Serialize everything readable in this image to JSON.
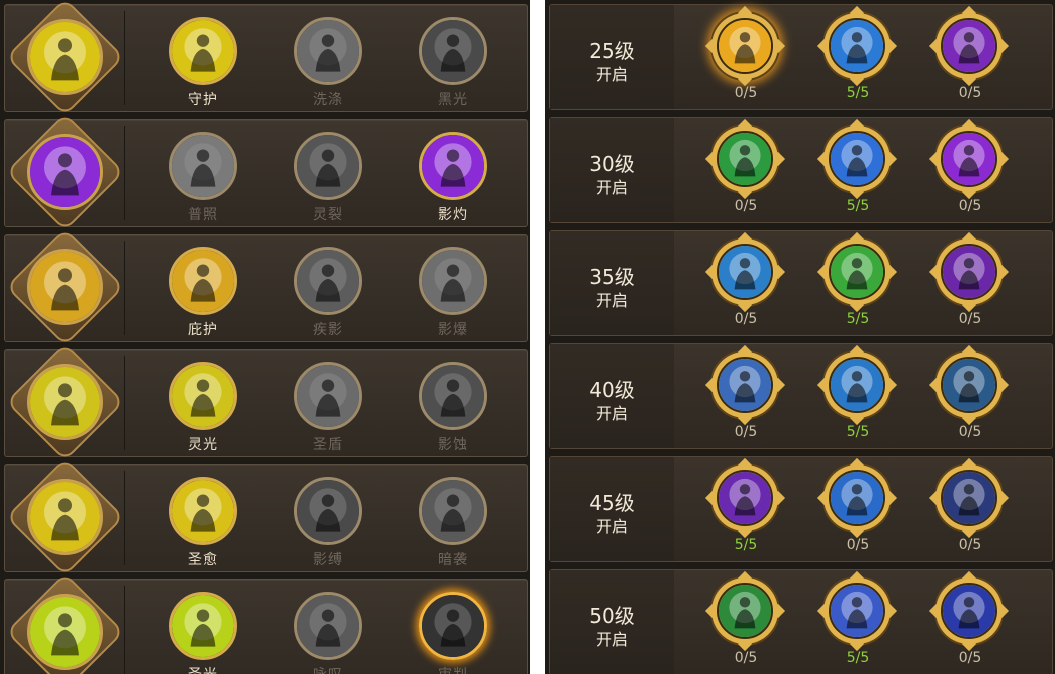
{
  "left_panel": {
    "rows": [
      {
        "base_icon": "hand-holding-light-icon",
        "base_color": "#d9c415",
        "skills": [
          {
            "name": "守护",
            "icon": "hand-holding-light-icon",
            "learned": true,
            "color": "#d9c415"
          },
          {
            "name": "洗涤",
            "icon": "light-pillar-icon",
            "learned": false,
            "color": "#6b6b6b"
          },
          {
            "name": "黑光",
            "icon": "dark-orb-icon",
            "learned": false,
            "color": "#4a4a4a"
          }
        ]
      },
      {
        "base_icon": "shadow-figure-icon",
        "base_color": "#8a2bd6",
        "skills": [
          {
            "name": "普照",
            "icon": "radiant-figure-icon",
            "learned": false,
            "color": "#7a7a7a"
          },
          {
            "name": "灵裂",
            "icon": "spirit-rift-icon",
            "learned": false,
            "color": "#555555"
          },
          {
            "name": "影灼",
            "icon": "shadow-figure-icon",
            "learned": true,
            "color": "#8a2bd6"
          }
        ]
      },
      {
        "base_icon": "shield-icon",
        "base_color": "#d8a520",
        "skills": [
          {
            "name": "庇护",
            "icon": "shield-icon",
            "learned": true,
            "color": "#d8a520"
          },
          {
            "name": "疾影",
            "icon": "shatter-icon",
            "learned": false,
            "color": "#5c5c5c"
          },
          {
            "name": "影爆",
            "icon": "light-pillar-icon",
            "learned": false,
            "color": "#6e6e6e"
          }
        ]
      },
      {
        "base_icon": "glowing-palm-icon",
        "base_color": "#cfc21a",
        "skills": [
          {
            "name": "灵光",
            "icon": "glowing-palm-icon",
            "learned": true,
            "color": "#cfc21a"
          },
          {
            "name": "圣盾",
            "icon": "holy-shield-icon",
            "learned": false,
            "color": "#6b6b6b"
          },
          {
            "name": "影蚀",
            "icon": "shadow-clones-icon",
            "learned": false,
            "color": "#4f4f4f"
          }
        ]
      },
      {
        "base_icon": "sunburst-hand-icon",
        "base_color": "#d8c018",
        "skills": [
          {
            "name": "圣愈",
            "icon": "sunburst-hand-icon",
            "learned": true,
            "color": "#d8c018"
          },
          {
            "name": "影缚",
            "icon": "shadow-strike-icon",
            "learned": false,
            "color": "#4a4a4a"
          },
          {
            "name": "暗袭",
            "icon": "comet-icon",
            "learned": false,
            "color": "#5a5a5a"
          }
        ]
      },
      {
        "base_icon": "holy-light-figure-icon",
        "base_color": "#b8d21a",
        "skills": [
          {
            "name": "圣光",
            "icon": "holy-light-figure-icon",
            "learned": true,
            "color": "#b8d21a"
          },
          {
            "name": "咏叹",
            "icon": "crowd-icon",
            "learned": false,
            "color": "#5a5a5a"
          },
          {
            "name": "审判",
            "icon": "dark-figure-icon",
            "learned": false,
            "highlight": true,
            "color": "#333333"
          }
        ]
      }
    ]
  },
  "right_panel": {
    "rows": [
      {
        "level": "25级",
        "open": "开启",
        "talents": [
          {
            "icon": "golden-cross-icon",
            "count": "0/5",
            "color": "#e9a820",
            "glow": true
          },
          {
            "icon": "blue-warrior-icon",
            "count": "5/5",
            "color": "#2a7ad6"
          },
          {
            "icon": "purple-claw-icon",
            "count": "0/5",
            "color": "#7a2ab8"
          }
        ]
      },
      {
        "level": "30级",
        "open": "开启",
        "talents": [
          {
            "icon": "green-figure-icon",
            "count": "0/5",
            "color": "#2c9a3e"
          },
          {
            "icon": "blue-impact-icon",
            "count": "5/5",
            "color": "#2f6fd8"
          },
          {
            "icon": "purple-wave-icon",
            "count": "0/5",
            "color": "#8a2ad0"
          }
        ]
      },
      {
        "level": "35级",
        "open": "开启",
        "talents": [
          {
            "icon": "lightning-strike-icon",
            "count": "0/5",
            "color": "#2a7fc8"
          },
          {
            "icon": "green-heal-cross-icon",
            "count": "5/5",
            "color": "#3aa83a"
          },
          {
            "icon": "hooded-mage-icon",
            "count": "0/5",
            "color": "#6a28a8"
          }
        ]
      },
      {
        "level": "40级",
        "open": "开启",
        "talents": [
          {
            "icon": "golden-warrior-icon",
            "count": "0/5",
            "color": "#3a6ab8"
          },
          {
            "icon": "winged-crest-icon",
            "count": "5/5",
            "color": "#2a78c8"
          },
          {
            "icon": "spirit-figure-icon",
            "count": "0/5",
            "color": "#2a5a8a"
          }
        ]
      },
      {
        "level": "45级",
        "open": "开启",
        "talents": [
          {
            "icon": "purple-hood-icon",
            "count": "5/5",
            "color": "#6a2ab0"
          },
          {
            "icon": "golden-shield-icon",
            "count": "0/5",
            "color": "#2a6ac8"
          },
          {
            "icon": "wizard-hat-icon",
            "count": "0/5",
            "color": "#2a3a7a"
          }
        ]
      },
      {
        "level": "50级",
        "open": "开启",
        "talents": [
          {
            "icon": "green-flexing-figure-icon",
            "count": "0/5",
            "color": "#2c8a3a"
          },
          {
            "icon": "golden-angel-icon",
            "count": "5/5",
            "color": "#3a5ac8"
          },
          {
            "icon": "blue-vortex-icon",
            "count": "0/5",
            "color": "#2a3aa8"
          }
        ]
      }
    ]
  }
}
